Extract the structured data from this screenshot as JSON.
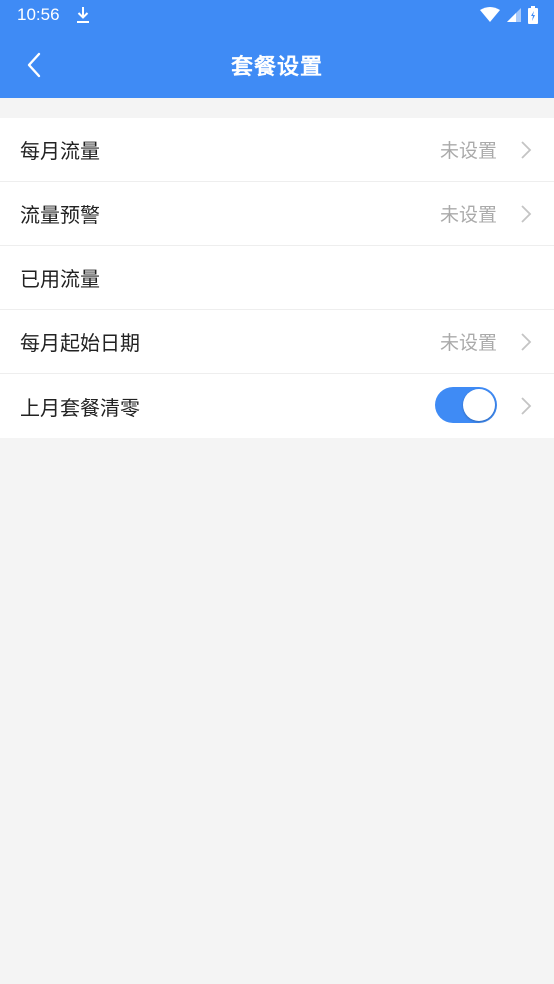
{
  "status_bar": {
    "time": "10:56",
    "icons": [
      "download-icon",
      "wifi-icon",
      "signal-icon",
      "battery-icon"
    ]
  },
  "header": {
    "title": "套餐设置",
    "back_icon": "chevron-left-icon"
  },
  "settings": [
    {
      "label": "每月流量",
      "value": "未设置",
      "has_chevron": true
    },
    {
      "label": "流量预警",
      "value": "未设置",
      "has_chevron": true
    },
    {
      "label": "已用流量",
      "value": "",
      "has_chevron": false
    },
    {
      "label": "每月起始日期",
      "value": "未设置",
      "has_chevron": true
    },
    {
      "label": "上月套餐清零",
      "toggle_on": true,
      "has_chevron": true
    }
  ],
  "colors": {
    "accent": "#3f8bf5",
    "background": "#f4f4f4",
    "value_text": "#aaaaaa"
  }
}
